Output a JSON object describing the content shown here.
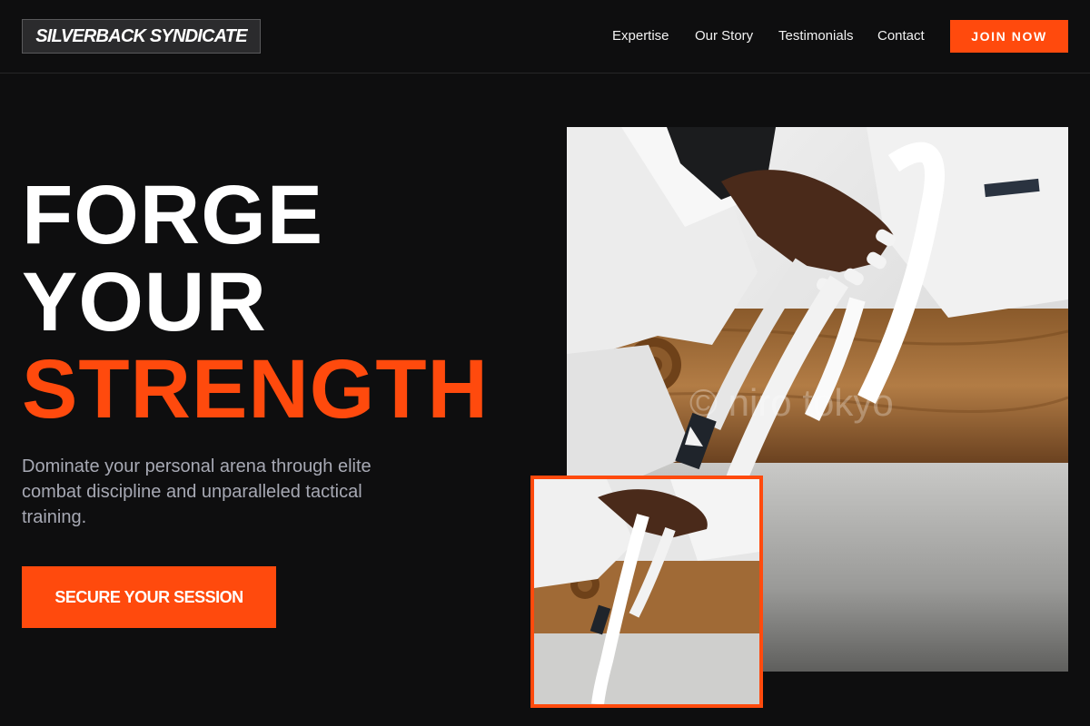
{
  "brand": {
    "logo": "SILVERBACK SYNDICATE"
  },
  "nav": {
    "items": [
      "Expertise",
      "Our Story",
      "Testimonials",
      "Contact"
    ],
    "join_label": "JOIN NOW"
  },
  "hero": {
    "headline": [
      "FORGE",
      "YOUR",
      "STRENGTH"
    ],
    "subtitle": "Dominate your personal arena through elite combat discipline and unparalleled tactical training.",
    "cta_label": "SECURE YOUR SESSION",
    "image_watermark": "© niro tokyo"
  },
  "colors": {
    "accent": "#ff4a0d",
    "background": "#0e0e0f",
    "text": "#ffffff",
    "muted_text": "#a7a9b4"
  },
  "icons": []
}
